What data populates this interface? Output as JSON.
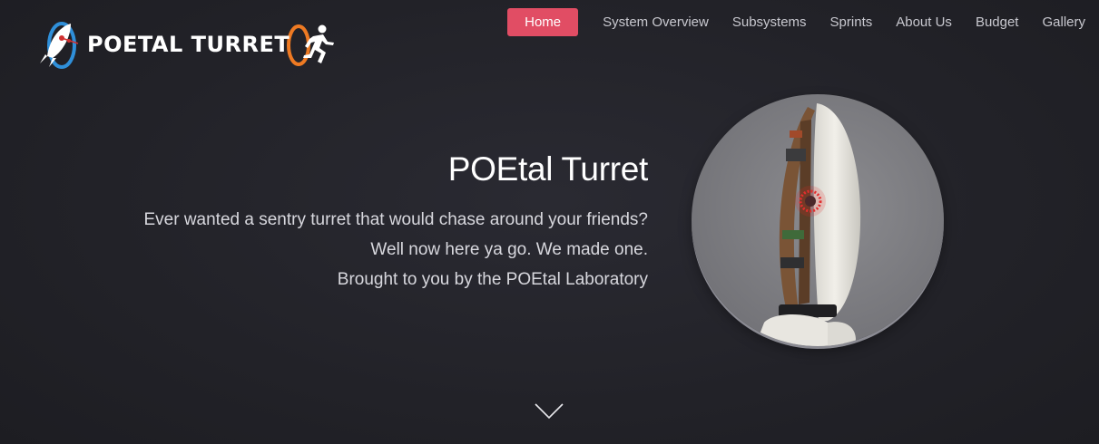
{
  "header": {
    "logo_text": "POETAL TURRET",
    "icons": [
      "rocket-icon",
      "running-man-icon"
    ]
  },
  "nav": {
    "items": [
      {
        "label": "Home",
        "active": true
      },
      {
        "label": "System Overview",
        "active": false
      },
      {
        "label": "Subsystems",
        "active": false
      },
      {
        "label": "Sprints",
        "active": false
      },
      {
        "label": "About Us",
        "active": false
      },
      {
        "label": "Budget",
        "active": false
      },
      {
        "label": "Gallery",
        "active": false
      }
    ]
  },
  "hero": {
    "title": "POEtal Turret",
    "lines": [
      "Ever wanted a sentry turret that would chase around your friends?",
      "Well now here ya go. We made one.",
      "Brought to you by the POEtal Laboratory"
    ],
    "image_alt": "turret-photo"
  },
  "scroll": {
    "icon": "chevron-down-icon"
  },
  "colors": {
    "accent": "#e14d64",
    "background": "#222228",
    "portal_blue": "#2f8fd9",
    "portal_orange": "#ee7a23"
  }
}
